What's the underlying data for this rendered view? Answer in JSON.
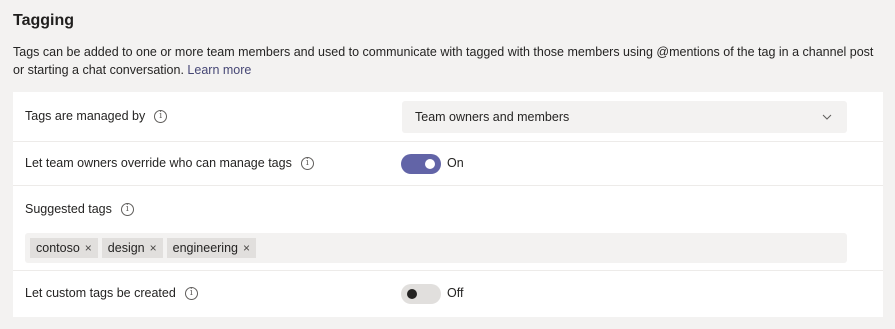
{
  "section": {
    "title": "Tagging",
    "description": "Tags can be added to one or more team members and used to communicate with tagged with those members using @mentions of the tag in a channel post or starting a chat conversation.",
    "learn_more": "Learn more"
  },
  "rows": {
    "managed_by": {
      "label": "Tags are managed by",
      "value": "Team owners and members"
    },
    "override": {
      "label": "Let team owners override who can manage tags",
      "state": "On"
    },
    "suggested": {
      "label": "Suggested tags",
      "tags": [
        "contoso",
        "design",
        "engineering"
      ]
    },
    "custom": {
      "label": "Let custom tags be created",
      "state": "Off"
    }
  },
  "icons": {
    "info": "i",
    "remove": "×"
  },
  "colors": {
    "accent": "#6264a7",
    "link": "#464775"
  }
}
